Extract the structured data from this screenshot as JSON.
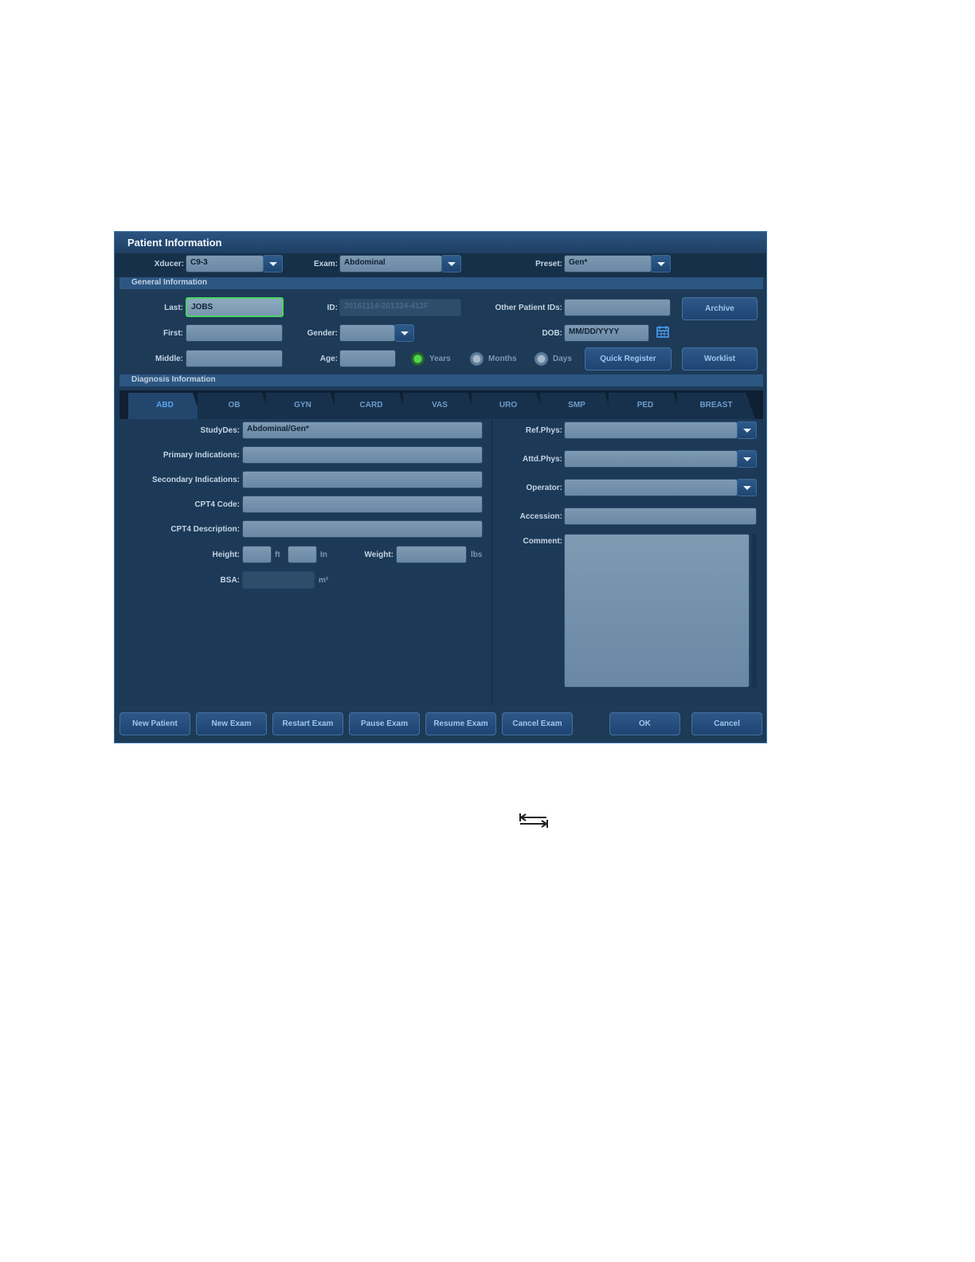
{
  "dialog": {
    "title": "Patient Information",
    "xducer_label": "Xducer:",
    "xducer_value": "C9-3",
    "exam_label": "Exam:",
    "exam_value": "Abdominal",
    "preset_label": "Preset:",
    "preset_value": "Gen*"
  },
  "general": {
    "header": "General Information",
    "last_label": "Last:",
    "last_value": "JOBS",
    "first_label": "First:",
    "first_value": "",
    "middle_label": "Middle:",
    "middle_value": "",
    "id_label": "ID:",
    "id_value": "20161114-201324-412F",
    "gender_label": "Gender:",
    "gender_value": "",
    "age_label": "Age:",
    "age_value": "",
    "age_units": [
      "Years",
      "Months",
      "Days"
    ],
    "age_unit_selected": "Years",
    "other_ids_label": "Other Patient IDs:",
    "other_ids_value": "",
    "dob_label": "DOB:",
    "dob_value": "MM/DD/YYYY",
    "quick_register": "Quick Register",
    "archive": "Archive",
    "worklist": "Worklist"
  },
  "diagnosis": {
    "header": "Diagnosis Information",
    "tabs": [
      "ABD",
      "OB",
      "GYN",
      "CARD",
      "VAS",
      "URO",
      "SMP",
      "PED",
      "BREAST"
    ],
    "active_tab": "ABD",
    "studydes_label": "StudyDes:",
    "studydes_value": "Abdominal/Gen*",
    "primary_label": "Primary Indications:",
    "secondary_label": "Secondary Indications:",
    "cpt4_code_label": "CPT4 Code:",
    "cpt4_desc_label": "CPT4 Description:",
    "height_label": "Height:",
    "ft_unit": "ft",
    "in_unit": "In",
    "weight_label": "Weight:",
    "lbs_unit": "lbs",
    "bsa_label": "BSA:",
    "bsa_unit": "m²",
    "ref_phys_label": "Ref.Phys:",
    "attd_phys_label": "Attd.Phys:",
    "operator_label": "Operator:",
    "accession_label": "Accession:",
    "comment_label": "Comment:"
  },
  "buttons": {
    "new_patient": "New Patient",
    "new_exam": "New Exam",
    "restart_exam": "Restart Exam",
    "pause_exam": "Pause Exam",
    "resume_exam": "Resume Exam",
    "cancel_exam": "Cancel Exam",
    "ok": "OK",
    "cancel": "Cancel"
  },
  "icons": {
    "calendar": "calendar-icon",
    "tab_key": "tab-key-icon"
  },
  "colors": {
    "panel": "#1d3a57",
    "accent": "#5aa3f0",
    "active_field_border": "#48d660"
  }
}
